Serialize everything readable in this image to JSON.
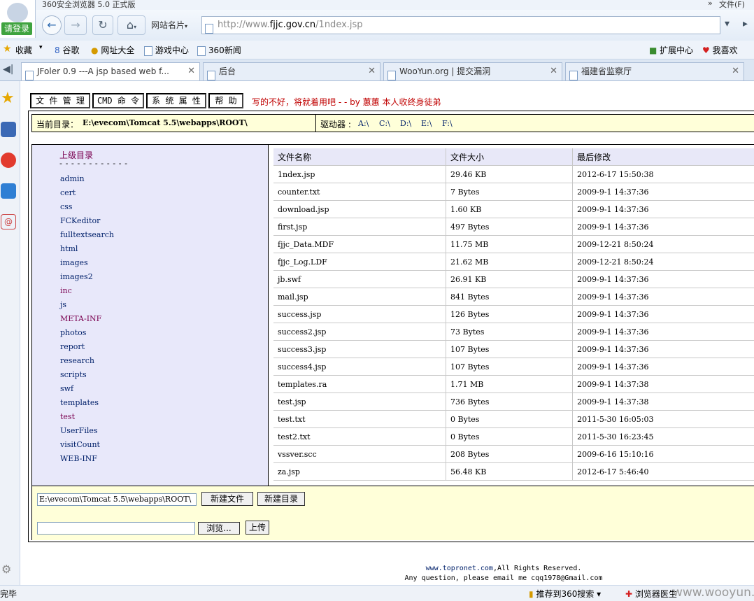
{
  "window": {
    "title": "360安全浏览器 5.0 正式版",
    "file_menu": "文件(F)"
  },
  "account": {
    "login_label": "请登录"
  },
  "address": {
    "site_card_label": "网站名片",
    "url_prefix": "http://www.",
    "url_domain": "fjjc.gov.cn",
    "url_path": "/1ndex.jsp"
  },
  "favorites": {
    "collect_label": "收藏",
    "items": [
      "谷歌",
      "网址大全",
      "游戏中心",
      "360新闻"
    ],
    "extensions_label": "扩展中心",
    "like_label": "我喜欢"
  },
  "tabs": [
    {
      "label": "JFoler 0.9 ---A jsp based web f..."
    },
    {
      "label": "后台"
    },
    {
      "label": "WooYun.org | 提交漏洞"
    },
    {
      "label": "福建省监察厅"
    }
  ],
  "page": {
    "menu": [
      "文 件 管 理",
      "CMD 命 令",
      "系 统 属 性",
      "帮 助"
    ],
    "slogan": "写的不好，将就着用吧 - - by 蕙蕙 本人收终身徒弟",
    "current_dir_label": "当前目录：",
    "current_dir": "E:\\evecom\\Tomcat 5.5\\webapps\\ROOT\\",
    "drives_label": "驱动器 :",
    "drives": [
      "A:\\",
      "C:\\",
      "D:\\",
      "E:\\",
      "F:\\"
    ],
    "parent_dir": "上级目录",
    "separator": "- - - - - - - - - - - -",
    "dirs": [
      "admin",
      "cert",
      "css",
      "FCKeditor",
      "fulltextsearch",
      "html",
      "images",
      "images2",
      "inc",
      "js",
      "META-INF",
      "photos",
      "report",
      "research",
      "scripts",
      "swf",
      "templates",
      "test",
      "UserFiles",
      "visitCount",
      "WEB-INF"
    ],
    "visited_dirs": [
      "inc",
      "META-INF",
      "test"
    ],
    "columns": [
      "文件名称",
      "文件大小",
      "最后修改"
    ],
    "files": [
      [
        "1ndex.jsp",
        "29.46 KB",
        "2012-6-17 15:50:38"
      ],
      [
        "counter.txt",
        "7 Bytes",
        "2009-9-1 14:37:36"
      ],
      [
        "download.jsp",
        "1.60 KB",
        "2009-9-1 14:37:36"
      ],
      [
        "first.jsp",
        "497 Bytes",
        "2009-9-1 14:37:36"
      ],
      [
        "fjjc_Data.MDF",
        "11.75 MB",
        "2009-12-21 8:50:24"
      ],
      [
        "fjjc_Log.LDF",
        "21.62 MB",
        "2009-12-21 8:50:24"
      ],
      [
        "jb.swf",
        "26.91 KB",
        "2009-9-1 14:37:36"
      ],
      [
        "mail.jsp",
        "841 Bytes",
        "2009-9-1 14:37:36"
      ],
      [
        "success.jsp",
        "126 Bytes",
        "2009-9-1 14:37:36"
      ],
      [
        "success2.jsp",
        "73 Bytes",
        "2009-9-1 14:37:36"
      ],
      [
        "success3.jsp",
        "107 Bytes",
        "2009-9-1 14:37:36"
      ],
      [
        "success4.jsp",
        "107 Bytes",
        "2009-9-1 14:37:36"
      ],
      [
        "templates.ra",
        "1.71 MB",
        "2009-9-1 14:37:38"
      ],
      [
        "test.jsp",
        "736 Bytes",
        "2009-9-1 14:37:38"
      ],
      [
        "test.txt",
        "0 Bytes",
        "2011-5-30 16:05:03"
      ],
      [
        "test2.txt",
        "0 Bytes",
        "2011-5-30 16:23:45"
      ],
      [
        "vssver.scc",
        "208 Bytes",
        "2009-6-16 15:10:16"
      ],
      [
        "za.jsp",
        "56.48 KB",
        "2012-6-17 5:46:40"
      ]
    ],
    "path_input_value": "E:\\evecom\\Tomcat 5.5\\webapps\\ROOT\\",
    "new_file_label": "新建文件",
    "new_dir_label": "新建目录",
    "browse_label": "浏览...",
    "upload_label": "上传",
    "footer_link": "www.topronet.com",
    "footer_rights": ",All Rights Reserved.",
    "footer_contact": "Any question, please email me cqq1978@Gmail.com"
  },
  "status": {
    "left": "完毕",
    "search_label": "推荐到360搜索",
    "doctor_label": "浏览器医生",
    "watermark": "www.wooyun.org"
  },
  "colors": {
    "path_bar_bg": "#ffffd9",
    "dir_panel_bg": "#e8e8fa",
    "slogan": "#c00000",
    "login_badge": "#3fa33f"
  },
  "icons": [
    "back-icon",
    "forward-icon",
    "refresh-icon",
    "home-icon",
    "page-icon",
    "star-icon",
    "close-icon",
    "gear-icon",
    "weibo-icon",
    "news-icon",
    "mobile-icon",
    "mail-icon"
  ]
}
